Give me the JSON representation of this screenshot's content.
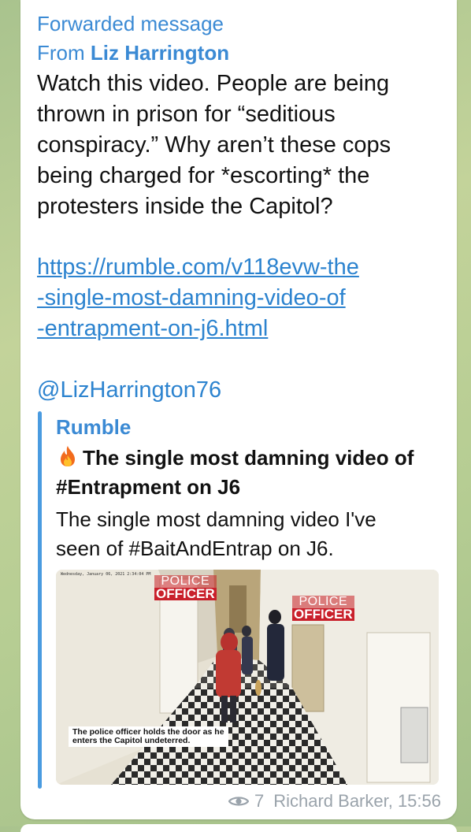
{
  "forward": {
    "label": "Forwarded message",
    "from_prefix": "From ",
    "from_name": "Liz Harrington"
  },
  "message": {
    "text_lines": [
      "Watch this video. People are being",
      "thrown in prison for “seditious",
      "conspiracy.” Why aren’t these cops",
      "being charged for *escorting* the",
      "protesters inside the Capitol?"
    ],
    "link_lines": [
      "https://rumble.com/v118evw-the",
      "-single-most-damning-video-of",
      "-entrapment-on-j6.html"
    ],
    "mention": "@LizHarrington76"
  },
  "preview": {
    "site_name": "Rumble",
    "title_line1": "The single most damning video of",
    "title_line2": "#Entrapment on J6",
    "description_line1": "The single most damning video I've",
    "description_line2": "seen of #BaitAndEntrap on J6.",
    "image": {
      "timestamp": "Wednesday, January 06, 2021 2:34:04 PM",
      "label_left_line1": "POLICE",
      "label_left_line2": "OFFICER",
      "label_right_line1": "POLICE",
      "label_right_line2": "OFFICER",
      "caption_line1": "The police officer holds the door as he",
      "caption_line2": "enters the Capitol undeterred."
    }
  },
  "footer": {
    "icon": "eye-icon",
    "views": "7",
    "author_time": "Richard Barker, 15:56"
  },
  "colors": {
    "link": "#2c83cf",
    "accent": "#3b8ad4",
    "police_red": "#c9202b"
  }
}
